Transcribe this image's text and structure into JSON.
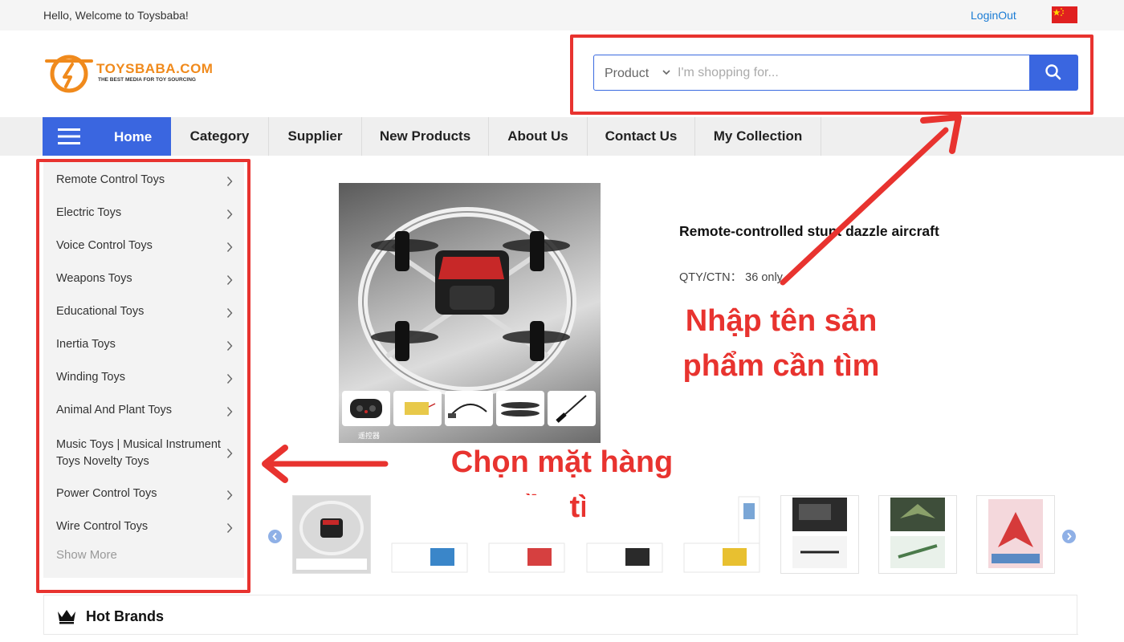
{
  "topbar": {
    "welcome": "Hello, Welcome to Toysbaba!",
    "login": "LoginOut",
    "flag_icon": "china-flag-icon"
  },
  "logo": {
    "name": "TOYSBABA.COM",
    "tagline": "THE BEST MEDIA FOR TOY SOURCING",
    "color": "#f08a1c"
  },
  "search": {
    "category": "Product",
    "placeholder": "I'm shopping for...",
    "button_icon": "search-icon",
    "accent": "#3a66e0"
  },
  "nav": {
    "home": "Home",
    "items": [
      "Category",
      "Supplier",
      "New Products",
      "About Us",
      "Contact Us",
      "My Collection"
    ]
  },
  "sidebar": {
    "items": [
      "Remote Control Toys",
      "Electric Toys",
      "Voice Control Toys",
      "Weapons Toys",
      "Educational Toys",
      "Inertia Toys",
      "Winding Toys",
      "Animal And Plant Toys",
      "Music Toys | Musical Instrument Toys Novelty Toys",
      "Power Control Toys",
      "Wire Control Toys"
    ],
    "show_more": "Show More"
  },
  "product": {
    "title": "Remote-controlled stunt dazzle aircraft",
    "qty": "QTY/CTN： 36 only",
    "accessory_caption": "遥控器"
  },
  "annotations": {
    "search_hint_line1": "Nhập tên sản",
    "search_hint_line2": "phẩm cần tìm",
    "category_hint_line1": "Chọn mặt hàng",
    "category_hint_line2": "cần tìm",
    "color": "#e8332f"
  },
  "hot_brands": {
    "title": "Hot Brands",
    "icon": "crown-icon"
  }
}
